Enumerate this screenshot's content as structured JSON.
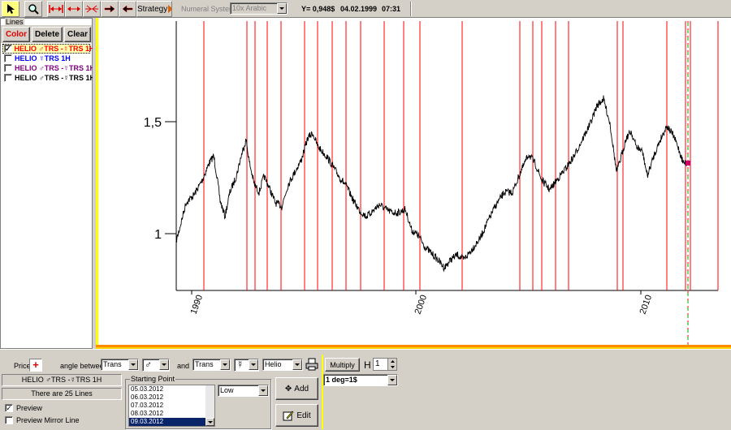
{
  "toolbar": {
    "strategy_label": "Strategy",
    "numeral_system_label": "Numeral System",
    "numeral_system_value": "10x Arabic",
    "y_readout": "Y= 0,948$",
    "date_readout": "04.02.1999",
    "time_readout": "07:31"
  },
  "lines_panel": {
    "title": "Lines",
    "color_button": "Color",
    "delete_button": "Delete",
    "clear_button": "Clear",
    "items": [
      {
        "label": "HELIO ♂TRS -☿TRS 1H",
        "checked": true,
        "color": "#ff0000"
      },
      {
        "label": "HELIO ☿TRS 1H",
        "checked": false,
        "color": "#0000ff"
      },
      {
        "label": "HELIO ♂TRS -☿TRS 1H",
        "checked": false,
        "color": "#800080"
      },
      {
        "label": "HELIO ♂TRS -☿TRS 1H",
        "checked": false,
        "color": "#000000"
      }
    ],
    "check_mark": "✓"
  },
  "chart_data": {
    "type": "line",
    "series": [
      {
        "name": "",
        "color": "#000000"
      }
    ],
    "y_ticks": [
      "1,5",
      "1"
    ],
    "x_ticks": [
      "1990",
      "2000",
      "2010"
    ],
    "vertical_line_color": "#ff0000",
    "cursor_point_color": "#cc0066"
  },
  "bottom": {
    "prices_label": "Prices",
    "prices_button": "+",
    "angle_between_label": "angle between",
    "first_planet_mode": "Trans",
    "first_planet": "♂",
    "and_label": "and",
    "second_planet_mode": "Trans",
    "second_planet": "☿",
    "system": "Helio",
    "multiply_button": "Multiply",
    "h_label": "H",
    "h_value": "1",
    "degree_value": "1 deg=1$",
    "current_line_label": "HELIO ♂TRS -☿TRS 1H",
    "lines_count": "There are 25 Lines",
    "preview_label": "Preview",
    "preview_mirror_label": "Preview Mirror Line",
    "preview_checked_mark": "✓",
    "starting_point_label": "Starting Point",
    "starting_dates": [
      "05.03.2012",
      "06.03.2012",
      "07.03.2012",
      "08.03.2012",
      "09.03.2012"
    ],
    "selected_date": "09.03.2012",
    "low_value": "Low",
    "add_button": "Add",
    "edit_button": "Edit"
  }
}
